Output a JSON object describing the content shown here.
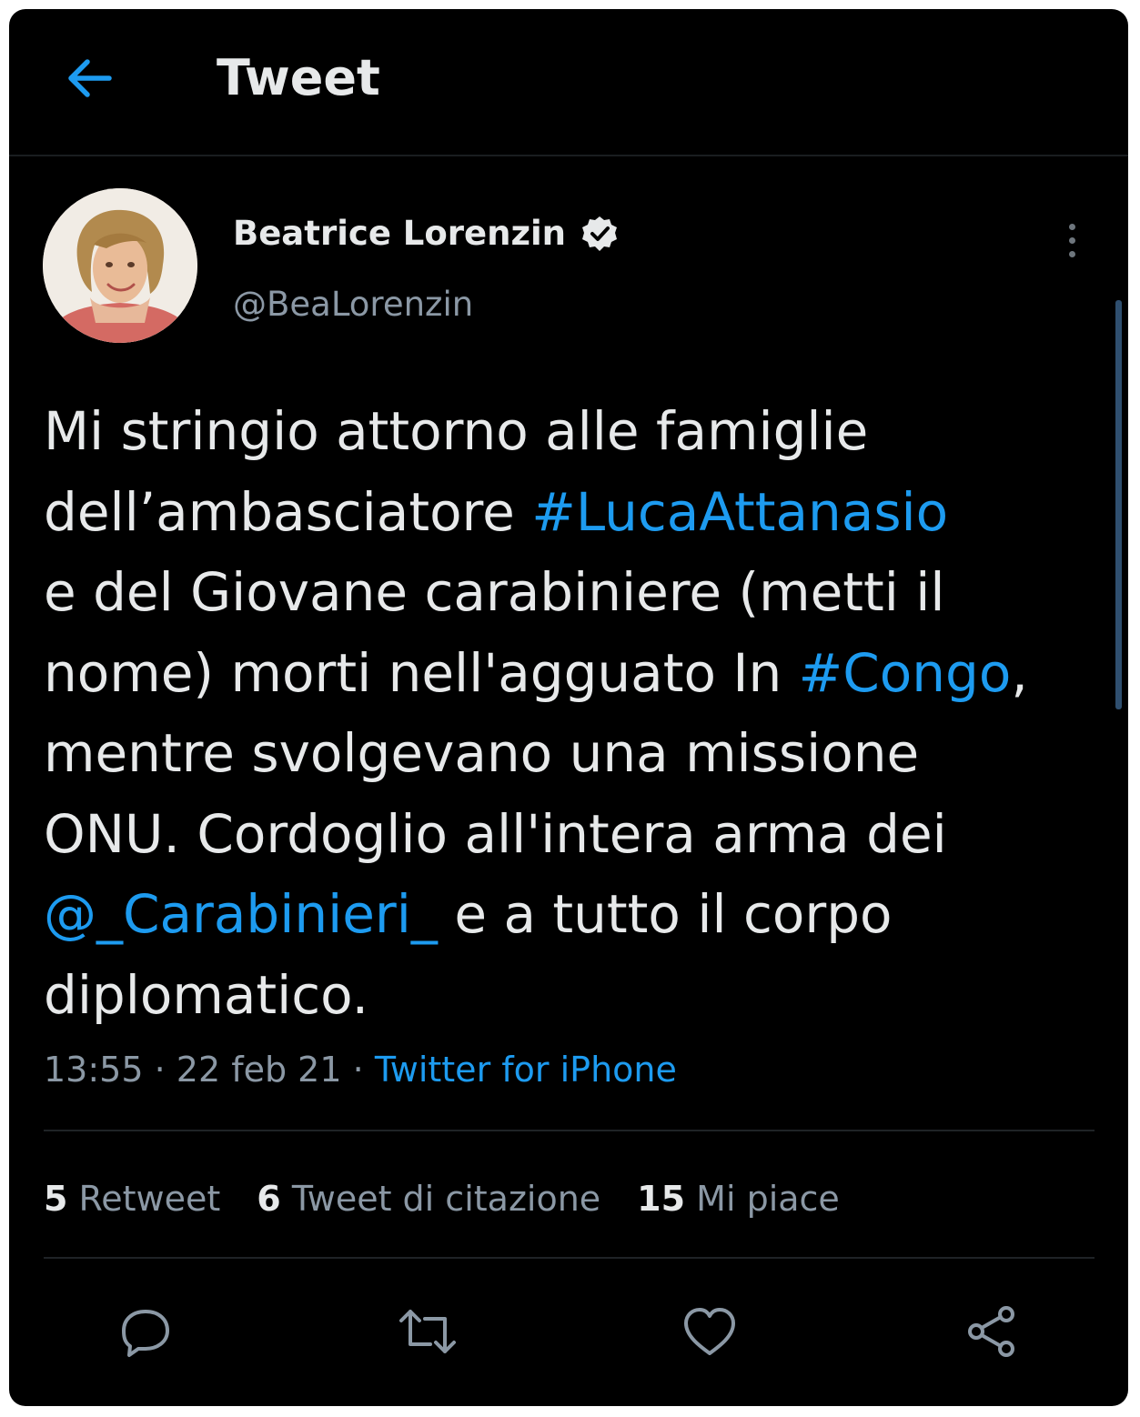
{
  "colors": {
    "background": "#000000",
    "text": "#e7e9ea",
    "muted": "#8b98a5",
    "accent": "#1d9bf0",
    "divider": "#1f2326"
  },
  "header": {
    "title": "Tweet",
    "back_icon": "arrow-left-icon"
  },
  "tweet": {
    "author": {
      "name": "Beatrice Lorenzin",
      "handle": "@BeaLorenzin",
      "verified_icon": "verified-badge-icon",
      "avatar": "avatar-photo"
    },
    "more_icon": "more-vertical-icon",
    "text_lines": [
      [
        {
          "text": "Mi stringio attorno alle famiglie"
        }
      ],
      [
        {
          "text": "dell’ambasciatore "
        },
        {
          "text": "#LucaAttanasio",
          "link": true
        }
      ],
      [
        {
          "text": "e del Giovane carabiniere (metti il"
        }
      ],
      [
        {
          "text": "nome) morti nell'agguato In "
        },
        {
          "text": "#Congo",
          "link": true
        },
        {
          "text": ","
        }
      ],
      [
        {
          "text": "mentre svolgevano una missione"
        }
      ],
      [
        {
          "text": "ONU. Cordoglio all'intera arma dei"
        }
      ],
      [
        {
          "text": "@_Carabinieri_",
          "link": true
        },
        {
          "text": " e a tutto il corpo"
        }
      ],
      [
        {
          "text": "diplomatico."
        }
      ]
    ],
    "time": "13:55",
    "separator": "·",
    "date": "22 feb 21",
    "source": "Twitter for iPhone"
  },
  "stats": {
    "retweets": {
      "count": "5",
      "label": "Retweet"
    },
    "quotes": {
      "count": "6",
      "label": "Tweet di citazione"
    },
    "likes": {
      "count": "15",
      "label": "Mi piace"
    }
  },
  "actions": [
    {
      "name": "reply",
      "icon": "comment-icon"
    },
    {
      "name": "retweet",
      "icon": "retweet-icon"
    },
    {
      "name": "like",
      "icon": "heart-icon"
    },
    {
      "name": "share",
      "icon": "share-icon"
    }
  ]
}
